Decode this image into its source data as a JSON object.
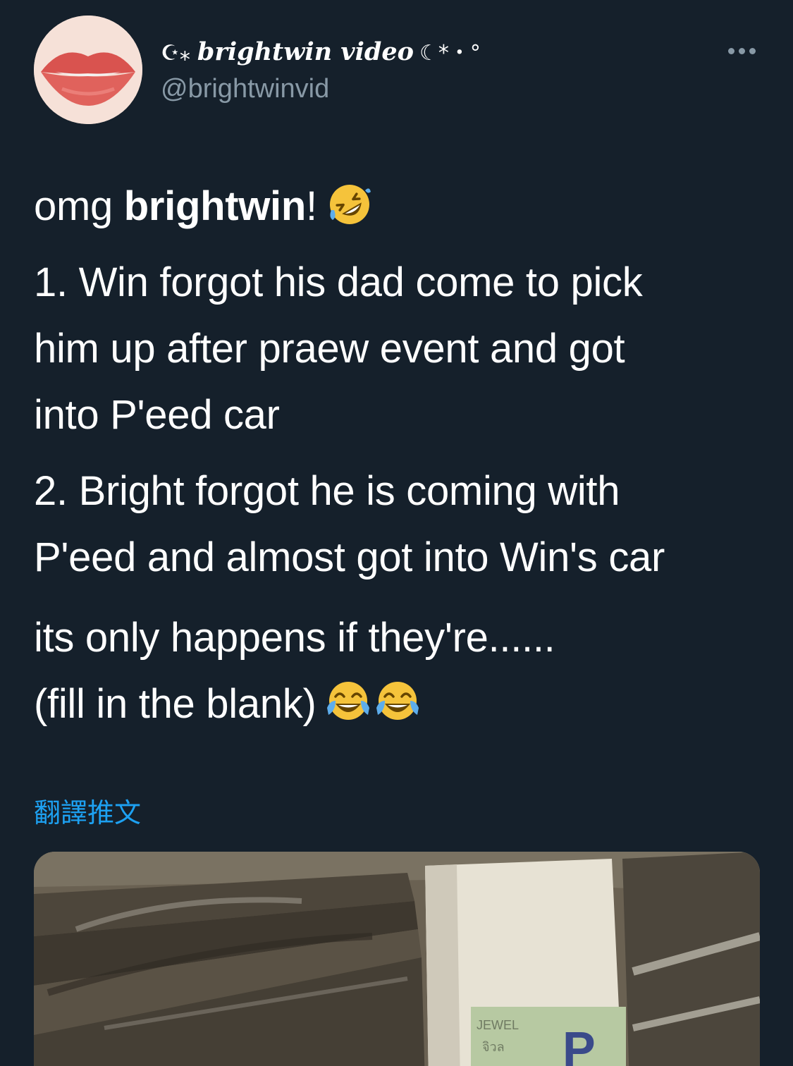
{
  "tweet": {
    "author": {
      "display_name": "brightwin video",
      "name_prefix_deco": "☪︎⁎",
      "name_suffix_deco": "☾*・°",
      "handle": "@brightwinvid",
      "avatar_icon": "lips-avatar"
    },
    "more_icon": "more-options-icon",
    "body": {
      "line1_pre": "omg ",
      "line1_bold": "brightwin",
      "line1_post": "!",
      "emoji_1": "rolling-on-floor-laughing-emoji",
      "item1_line1": "1. Win forgot his dad come to pick",
      "item1_line2": "him up after praew event and got",
      "item1_line3": "into P'eed car",
      "item2_line1": "2. Bright forgot he is coming with",
      "item2_line2": "P'eed and almost got into Win's car",
      "closing_line1": "its only happens if they're......",
      "closing_line2": "(fill in the blank)",
      "emoji_2": "face-with-tears-of-joy-emoji",
      "emoji_3": "face-with-tears-of-joy-emoji"
    },
    "translate_label": "翻譯推文",
    "media": {
      "sign_text_1": "JEWEL",
      "sign_text_2": "จิวล",
      "sign_letter": "P"
    }
  },
  "colors": {
    "background": "#15202b",
    "text": "#ffffff",
    "secondary": "#8899a6",
    "link": "#1da1f2"
  }
}
